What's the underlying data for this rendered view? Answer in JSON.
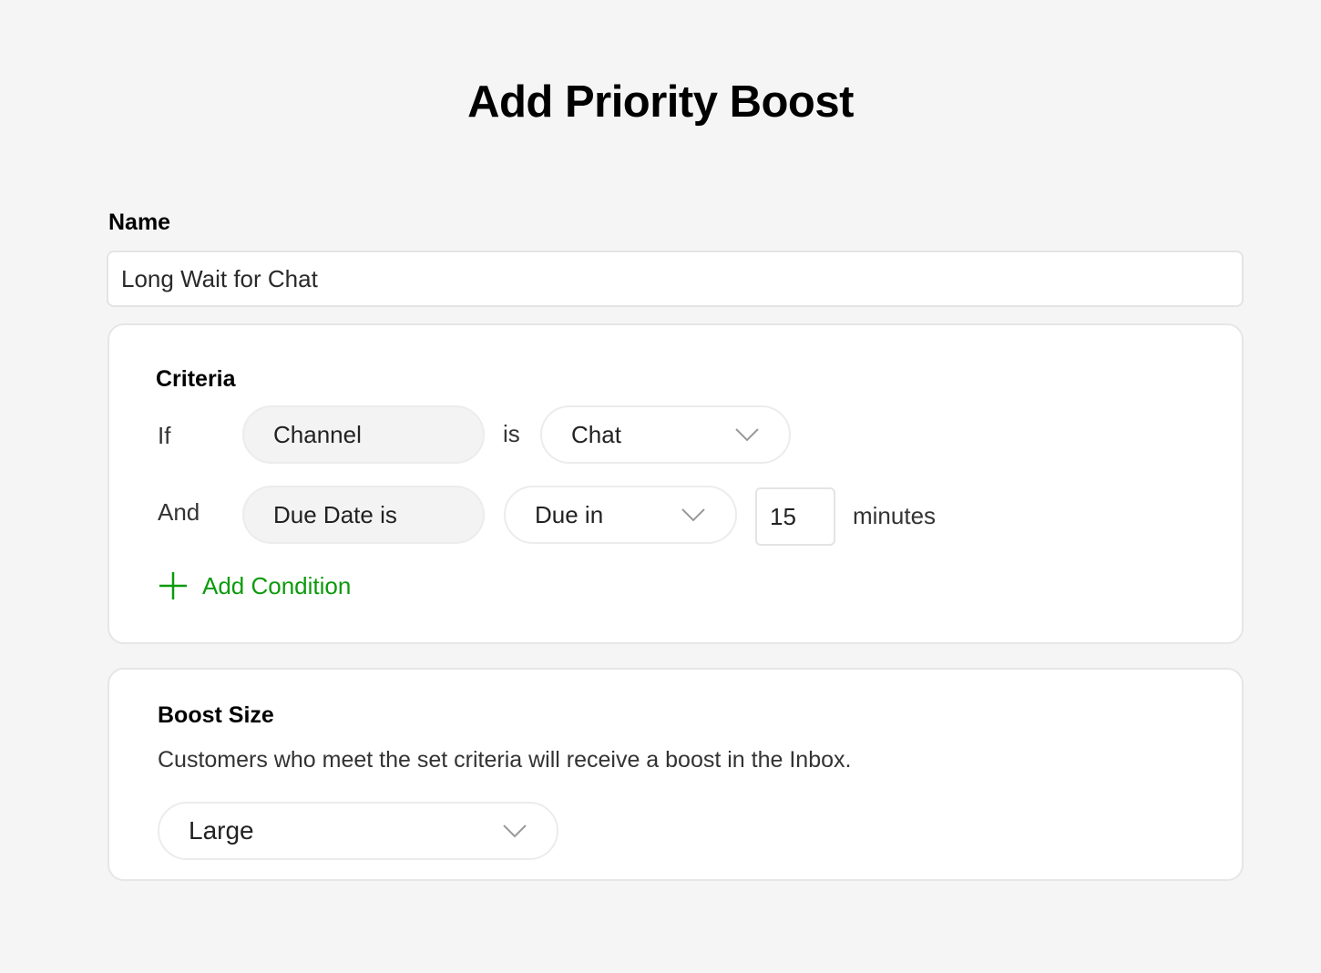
{
  "page": {
    "title": "Add Priority Boost"
  },
  "name_field": {
    "label": "Name",
    "value": "Long Wait for Chat"
  },
  "criteria": {
    "title": "Criteria",
    "rows": [
      {
        "connector": "If",
        "field": "Channel",
        "operator": "is",
        "value": "Chat"
      },
      {
        "connector": "And",
        "field": "Due Date is",
        "operator_select": "Due in",
        "amount": "15",
        "unit": "minutes"
      }
    ],
    "add_condition_label": "Add Condition",
    "accent_color": "#0c9a0c"
  },
  "boost": {
    "title": "Boost Size",
    "description": "Customers who meet the set criteria will receive a boost in the Inbox.",
    "selected": "Large"
  }
}
